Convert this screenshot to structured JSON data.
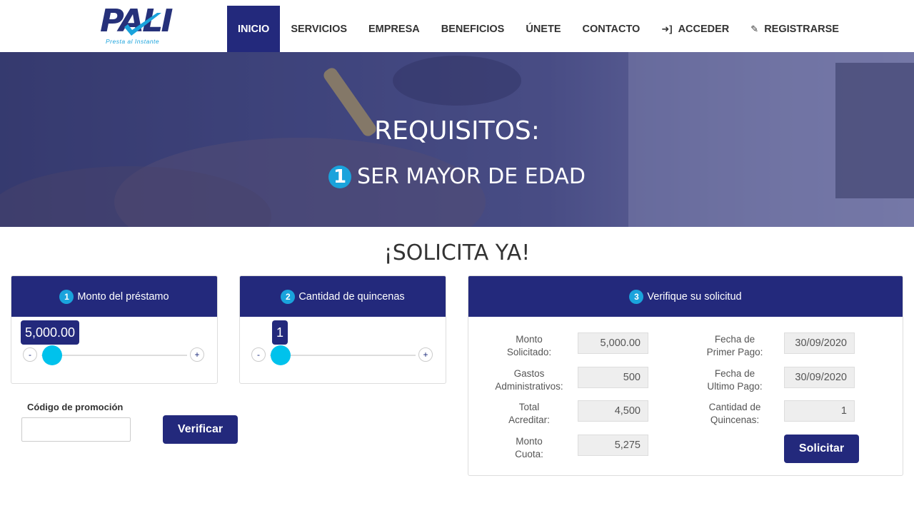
{
  "brand": {
    "name": "PALI",
    "tagline": "Presta al Instante",
    "colors": {
      "primary": "#23297c",
      "accent": "#1aa3dc",
      "knob": "#00c2ec"
    }
  },
  "nav": {
    "items": [
      {
        "label": "INICIO",
        "active": true
      },
      {
        "label": "SERVICIOS"
      },
      {
        "label": "EMPRESA"
      },
      {
        "label": "BENEFICIOS"
      },
      {
        "label": "ÚNETE"
      },
      {
        "label": "CONTACTO"
      },
      {
        "label": "ACCEDER",
        "icon": "sign-in-icon"
      },
      {
        "label": "REGISTRARSE",
        "icon": "edit-icon"
      }
    ]
  },
  "hero": {
    "title": "REQUISITOS:",
    "badge": "1",
    "requirement": "SER MAYOR DE EDAD"
  },
  "section": {
    "title": "¡SOLICITA YA!"
  },
  "amount_panel": {
    "step": "1",
    "title": "Monto del préstamo",
    "value": "5,000.00",
    "minus": "-",
    "plus": "+"
  },
  "installments_panel": {
    "step": "2",
    "title": "Cantidad de quincenas",
    "value": "1",
    "minus": "-",
    "plus": "+"
  },
  "promo": {
    "label": "Código de promoción",
    "value": "",
    "button": "Verificar"
  },
  "verify_panel": {
    "step": "3",
    "title": "Verifique su solicitud",
    "left": [
      {
        "label_1": "Monto",
        "label_2": "Solicitado:",
        "value": "5,000.00"
      },
      {
        "label_1": "Gastos",
        "label_2": "Administrativos:",
        "value": "500"
      },
      {
        "label_1": "Total",
        "label_2": "Acreditar:",
        "value": "4,500"
      },
      {
        "label_1": "Monto",
        "label_2": "Cuota:",
        "value": "5,275"
      }
    ],
    "right": [
      {
        "label_1": "Fecha de",
        "label_2": "Primer Pago:",
        "value": "30/09/2020"
      },
      {
        "label_1": "Fecha de",
        "label_2": "Ultimo Pago:",
        "value": "30/09/2020"
      },
      {
        "label_1": "Cantidad de",
        "label_2": "Quincenas:",
        "value": "1"
      }
    ],
    "submit": "Solicitar"
  }
}
